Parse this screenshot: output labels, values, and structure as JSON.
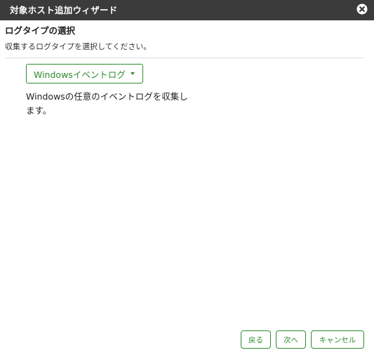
{
  "dialog": {
    "title": "対象ホスト追加ウィザード",
    "close_icon": "close-circle-icon"
  },
  "section": {
    "title": "ログタイプの選択",
    "description": "収集するログタイプを選択してください。"
  },
  "log_type": {
    "selected": "Windowsイベントログ",
    "caret_icon": "caret-down-icon",
    "description": "Windowsの任意のイベントログを収集します。"
  },
  "footer": {
    "back_label": "戻る",
    "next_label": "次へ",
    "cancel_label": "キャンセル"
  },
  "colors": {
    "titlebar": "#3b3b3b",
    "accent": "#2e8b2e"
  }
}
